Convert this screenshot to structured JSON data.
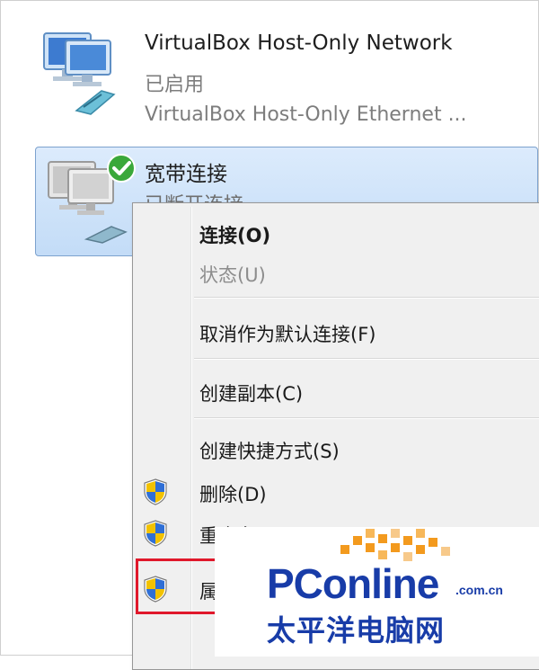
{
  "adapters": [
    {
      "name": "VirtualBox Host-Only Network",
      "status": "已启用",
      "device": "VirtualBox Host-Only Ethernet ..."
    },
    {
      "name": "宽带连接",
      "status": "已断开连接",
      "selected": true
    }
  ],
  "context_menu": {
    "items": [
      {
        "label": "连接(O)",
        "bold": true
      },
      {
        "label": "状态(U)",
        "disabled": true
      },
      {
        "label": "取消作为默认连接(F)"
      },
      {
        "label": "创建副本(C)"
      },
      {
        "label": "创建快捷方式(S)"
      },
      {
        "label": "删除(D)",
        "icon": "uac-shield-icon"
      },
      {
        "label": "重命名(M)",
        "icon": "uac-shield-icon"
      },
      {
        "label": "属性(R)",
        "icon": "uac-shield-icon",
        "highlighted": true
      }
    ]
  },
  "watermark": {
    "brand": "PConline",
    "domain": ".com.cn",
    "chinese": "太平洋电脑网"
  },
  "colors": {
    "selection": "#c3dcf7",
    "highlight_border": "#e0182b",
    "brand_blue": "#183ca8",
    "brand_orange": "#f39a1e"
  }
}
